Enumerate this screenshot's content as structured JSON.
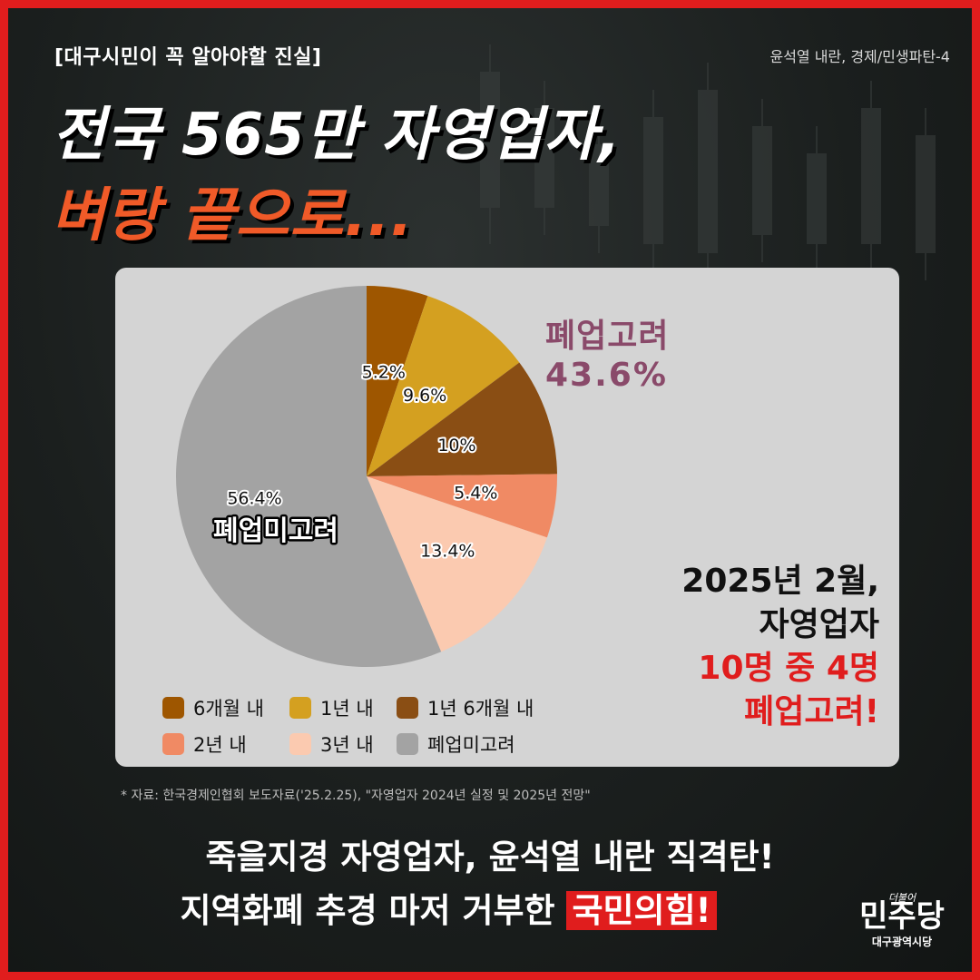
{
  "header": {
    "series_tag": "[대구시민이 꼭 알아야할 진실]",
    "series_sub": "윤석열 내란, 경제/민생파탄-4",
    "headline_line1": "전국 565만 자영업자,",
    "headline_line2": "벼랑 끝으로..."
  },
  "chart_data": {
    "type": "pie",
    "start_angle_deg": 0,
    "direction": "clockwise",
    "slices": [
      {
        "name": "6개월 내",
        "value": 5.2,
        "label": "5.2%",
        "color": "#9e5600"
      },
      {
        "name": "1년 내",
        "value": 9.6,
        "label": "9.6%",
        "color": "#d4a020"
      },
      {
        "name": "1년 6개월 내",
        "value": 10,
        "label": "10%",
        "color": "#8a4e14"
      },
      {
        "name": "2년 내",
        "value": 5.4,
        "label": "5.4%",
        "color": "#f08a64"
      },
      {
        "name": "3년 내",
        "value": 13.4,
        "label": "13.4%",
        "color": "#fbcab0"
      },
      {
        "name": "폐업미고려",
        "value": 56.4,
        "label": "56.4%",
        "color": "#a3a3a3"
      }
    ],
    "big_label": "폐업미고려",
    "callout": {
      "title": "폐업고려",
      "value": "43.6%",
      "color": "#8a4a6a"
    },
    "legend_position": "bottom-left"
  },
  "summary": {
    "line1": "2025년 2월,",
    "line2": "자영업자",
    "line3": "10명 중 4명",
    "line4": "폐업고려!"
  },
  "source": "* 자료: 한국경제인협회 보도자료('25.2.25), \"자영업자 2024년 실정 및 2025년 전망\"",
  "footer": {
    "line1": "죽을지경 자영업자, 윤석열 내란 직격탄!",
    "line2_prefix": "지역화폐 추경 마저 거부한 ",
    "line2_highlight": "국민의힘!"
  },
  "logo": {
    "small": "더불어",
    "main": "민주당",
    "sub": "대구광역시당"
  },
  "colors": {
    "frame": "#e01d1d",
    "accent_orange": "#f05a28",
    "callout_purple": "#8a4a6a",
    "summary_red": "#e01d1d"
  }
}
